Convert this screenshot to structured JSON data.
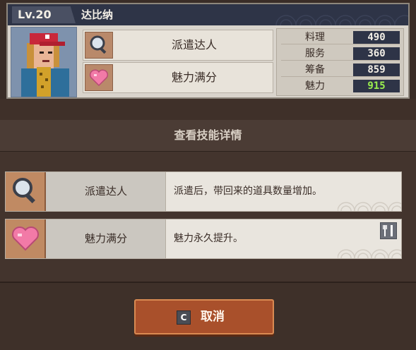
{
  "character": {
    "level": "Lv.20",
    "name": "达比纳",
    "skills": [
      {
        "label": "派遣达人",
        "icon": "magnifier-icon"
      },
      {
        "label": "魅力满分",
        "icon": "heart-icon"
      }
    ],
    "stats": [
      {
        "label": "料理",
        "value": "490",
        "highlight": false
      },
      {
        "label": "服务",
        "value": "360",
        "highlight": false
      },
      {
        "label": "筹备",
        "value": "859",
        "highlight": false
      },
      {
        "label": "魅力",
        "value": "915",
        "highlight": true
      }
    ]
  },
  "section": {
    "title": "查看技能详情"
  },
  "skill_details": [
    {
      "name": "派遣达人",
      "desc": "派遣后，带回来的道具数量增加。",
      "icon": "magnifier-icon"
    },
    {
      "name": "魅力满分",
      "desc": "魅力永久提升。",
      "icon": "heart-icon",
      "badge": "utensils-icon"
    }
  ],
  "cancel": {
    "key": "C",
    "label": "取消"
  },
  "colors": {
    "header": "#2e3447",
    "panel": "#d9d4cc",
    "stat_highlight": "#9af04e",
    "cancel_button": "#a9502b",
    "background": "#3a2d27"
  }
}
